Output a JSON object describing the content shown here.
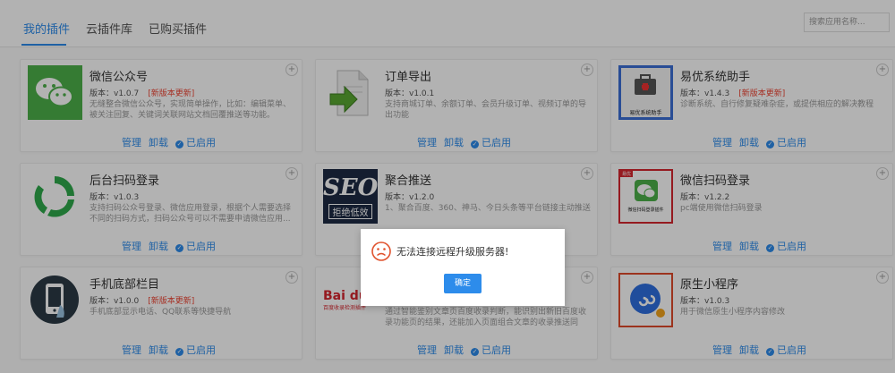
{
  "tabs": [
    {
      "label": "我的插件",
      "active": true
    },
    {
      "label": "云插件库",
      "active": false
    },
    {
      "label": "已购买插件",
      "active": false
    }
  ],
  "search": {
    "placeholder": "搜索应用名称..."
  },
  "actions": {
    "manage": "管理",
    "uninstall": "卸载",
    "enabled": "已启用"
  },
  "plugins": [
    {
      "name": "微信公众号",
      "version": "版本：v1.0.7",
      "badge": "[新版本更新]",
      "desc": "无缝整合微信公众号，实现简单操作，比如：编辑菜单、被关注回复、关键词关联网站文档回覆推送等功能。",
      "icon": "wechat-icon"
    },
    {
      "name": "订单导出",
      "version": "版本：v1.0.1",
      "badge": "",
      "desc": "支持商城订单、余额订单、会员升级订单、视频订单的导出功能",
      "icon": "export-document-icon"
    },
    {
      "name": "易优系统助手",
      "version": "版本：v1.4.3",
      "badge": "[新版本更新]",
      "desc": "诊断系统、自行修复疑难杂症，或提供相应的解决教程",
      "icon": "toolbox-icon",
      "thumb_caption": "易优系统助手"
    },
    {
      "name": "后台扫码登录",
      "version": "版本：v1.0.3",
      "badge": "",
      "desc": "支持扫码公众号登录、微信应用登录，根据个人需要选择不同的扫码方式，扫码公众号可以不需要申请微信应用...",
      "icon": "scan-login-icon"
    },
    {
      "name": "聚合推送",
      "version": "版本：v1.2.0",
      "badge": "",
      "desc": "1、聚合百度、360、神马、今日头条等平台链接主动推送",
      "icon": "seo-icon",
      "thumb_title": "SEO",
      "thumb_caption": "拒绝低效"
    },
    {
      "name": "微信扫码登录",
      "version": "版本：v1.2.2",
      "badge": "",
      "desc": "pc端使用微信扫码登录",
      "icon": "wechat-scan-icon",
      "thumb_tag": "易优",
      "thumb_caption": "微信扫码登录插件"
    },
    {
      "name": "手机底部栏目",
      "version": "版本：v1.0.0",
      "badge": "[新版本更新]",
      "desc": "手机底部显示电话、QQ联系等快捷导航",
      "icon": "mobile-icon"
    },
    {
      "name": "",
      "version": "",
      "badge": "",
      "desc": "通过智能鉴别文章页百度收录判断，能识别出新旧百度收录功能页的结果，还能加入页面组合文章的收录推送同时！",
      "icon": "baidu-icon",
      "thumb_title": "Bai du",
      "thumb_caption": "百度收录检测插件"
    },
    {
      "name": "原生小程序",
      "version": "版本：v1.0.3",
      "badge": "",
      "desc": "用于微信原生小程序内容修改",
      "icon": "miniprogram-icon"
    }
  ],
  "dialog": {
    "message": "无法连接远程升级服务器!",
    "ok_label": "确定",
    "icon": "sad-face-icon"
  }
}
